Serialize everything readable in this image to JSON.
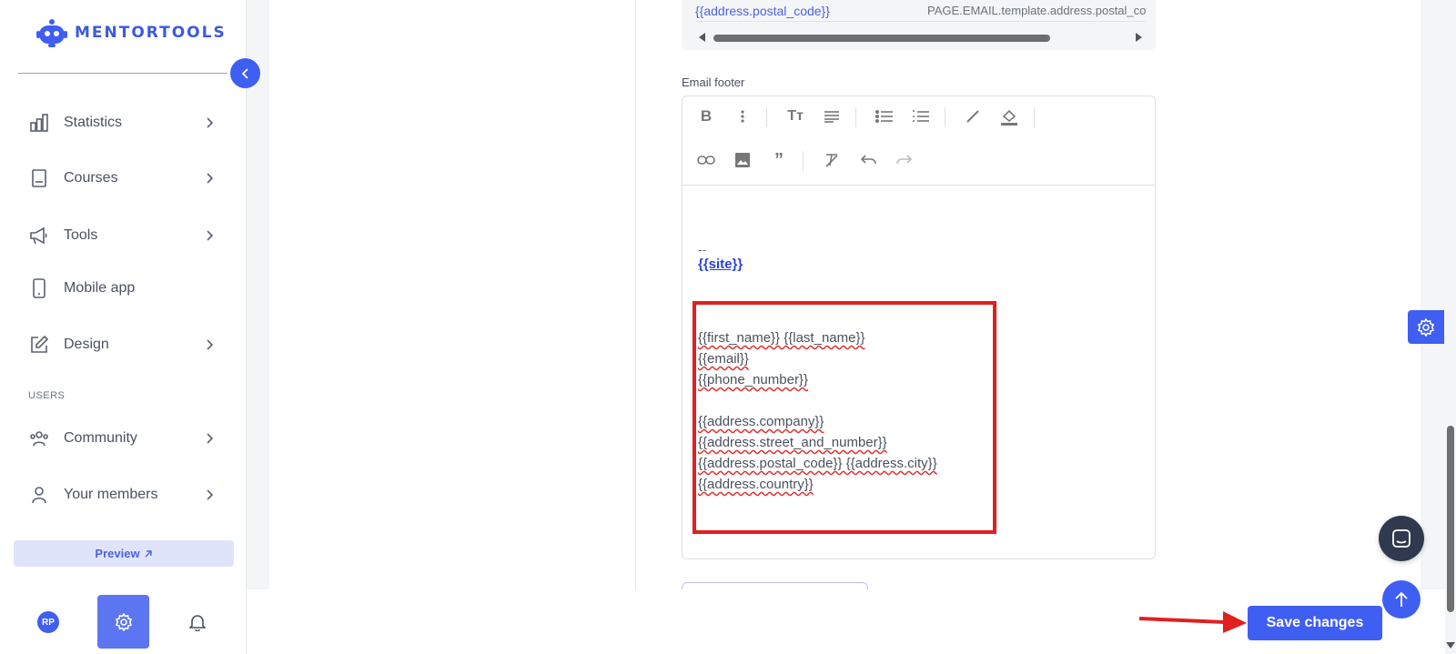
{
  "brand": {
    "name": "MENTORTOOLS",
    "accent": "#3f5ef2"
  },
  "sidebar": {
    "items": [
      {
        "label": "Statistics",
        "icon": "bar-chart-icon",
        "has_chevron": true
      },
      {
        "label": "Courses",
        "icon": "book-icon",
        "has_chevron": true
      },
      {
        "label": "Tools",
        "icon": "megaphone-icon",
        "has_chevron": true
      },
      {
        "label": "Mobile app",
        "icon": "phone-icon",
        "has_chevron": false
      },
      {
        "label": "Design",
        "icon": "edit-icon",
        "has_chevron": true
      },
      {
        "label": "Community",
        "icon": "people-icon",
        "has_chevron": true
      },
      {
        "label": "Your members",
        "icon": "user-icon",
        "has_chevron": true
      }
    ],
    "section_users": "USERS",
    "preview_label": "Preview",
    "avatar_initials": "RP"
  },
  "variables_table": {
    "row_key": "{{address.postal_code}}",
    "row_value": "PAGE.EMAIL.template.address.postal_code"
  },
  "email_footer": {
    "label": "Email footer",
    "separator": "--",
    "site_link": "{{site}}",
    "lines": [
      "{{first_name}} {{last_name}}",
      "{{email}}",
      "{{phone_number}}",
      "",
      "{{address.company}}",
      "{{address.street_and_number}}",
      "{{address.postal_code}} {{address.city}}",
      "{{address.country}}"
    ]
  },
  "actions": {
    "save_label": "Save changes"
  },
  "colors": {
    "highlight": "#e01f1f",
    "link": "#2b3fe0"
  }
}
